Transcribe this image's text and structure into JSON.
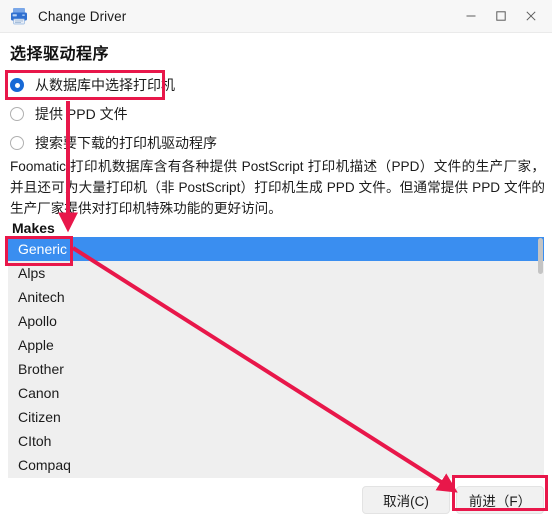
{
  "window": {
    "title": "Change Driver",
    "icon": "printer-icon",
    "controls": {
      "minimize": "minimize-icon",
      "maximize": "maximize-icon",
      "close": "close-icon"
    }
  },
  "heading": "选择驱动程序",
  "radio_options": [
    {
      "label": "从数据库中选择打印机",
      "selected": true
    },
    {
      "label": "提供 PPD 文件",
      "selected": false
    },
    {
      "label": "搜索要下载的打印机驱动程序",
      "selected": false
    }
  ],
  "description": "Foomatic 打印机数据库含有各种提供 PostScript 打印机描述（PPD）文件的生产厂家，并且还可为大量打印机（非 PostScript）打印机生成 PPD 文件。但通常提供 PPD 文件的生产厂家提供对打印机特殊功能的更好访问。",
  "list": {
    "label": "Makes",
    "items": [
      {
        "label": "Generic",
        "selected": true
      },
      {
        "label": "Alps",
        "selected": false
      },
      {
        "label": "Anitech",
        "selected": false
      },
      {
        "label": "Apollo",
        "selected": false
      },
      {
        "label": "Apple",
        "selected": false
      },
      {
        "label": "Brother",
        "selected": false
      },
      {
        "label": "Canon",
        "selected": false
      },
      {
        "label": "Citizen",
        "selected": false
      },
      {
        "label": "CItoh",
        "selected": false
      },
      {
        "label": "Compaq",
        "selected": false
      }
    ]
  },
  "footer": {
    "cancel_label": "取消(C)",
    "forward_label": "前进（F）"
  },
  "annotations": {
    "highlight_color": "#e8174a",
    "boxes": [
      "radio-from-database",
      "list-item-generic",
      "forward-button"
    ],
    "arrows": [
      "down-arrow-to-makes-list",
      "diagonal-arrow-to-forward-button"
    ]
  },
  "colors": {
    "selection_blue": "#3a8ef0",
    "radio_blue": "#1769d6",
    "list_background": "#efefef",
    "titlebar": "#f7f7f7"
  }
}
